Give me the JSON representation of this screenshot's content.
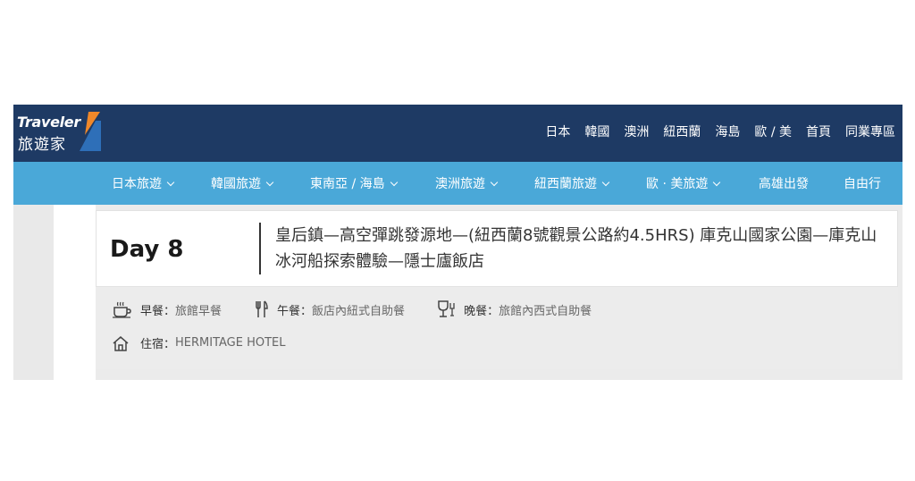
{
  "brand": {
    "name_en": "Traveler",
    "name_zh": "旅遊家",
    "primary_color": "#1e3a64",
    "secondary_color": "#4aa8d8",
    "logo_accent": [
      "#f0882a",
      "#2e6fb8"
    ]
  },
  "top_nav": [
    "日本",
    "韓國",
    "澳洲",
    "紐西蘭",
    "海島",
    "歐 / 美",
    "首頁",
    "同業專區"
  ],
  "sub_nav": [
    {
      "label": "日本旅遊",
      "dropdown": true
    },
    {
      "label": "韓國旅遊",
      "dropdown": true
    },
    {
      "label": "東南亞 / 海島",
      "dropdown": true
    },
    {
      "label": "澳洲旅遊",
      "dropdown": true
    },
    {
      "label": "紐西蘭旅遊",
      "dropdown": true
    },
    {
      "label": "歐 · 美旅遊",
      "dropdown": true
    },
    {
      "label": "高雄出發",
      "dropdown": false
    },
    {
      "label": "自由行",
      "dropdown": false
    }
  ],
  "itinerary": {
    "day": "Day 8",
    "route": "皇后鎮—高空彈跳發源地—(紐西蘭8號觀景公路約4.5HRS) 庫克山國家公園—庫克山冰河船探索體驗—隱士廬飯店",
    "meals": [
      {
        "icon": "coffee-cup-icon",
        "label": "早餐：",
        "value": "旅館早餐"
      },
      {
        "icon": "fork-knife-icon",
        "label": "午餐：",
        "value": "飯店內紐式自助餐"
      },
      {
        "icon": "wine-glass-icon",
        "label": "晚餐：",
        "value": "旅館內西式自助餐"
      }
    ],
    "stay": {
      "icon": "home-icon",
      "label": "住宿：",
      "value": "HERMITAGE HOTEL"
    }
  }
}
